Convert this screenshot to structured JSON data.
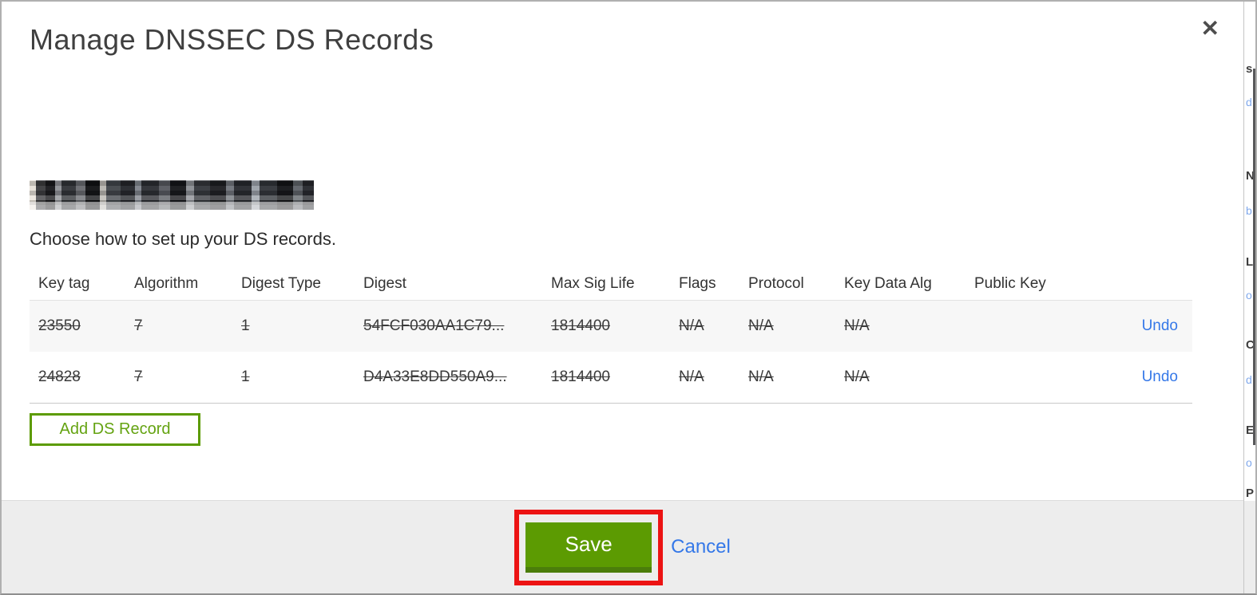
{
  "modal": {
    "title": "Manage DNSSEC DS Records",
    "close_glyph": "✕",
    "domain_redacted": true,
    "instruction": "Choose how to set up your DS records.",
    "table": {
      "headers": [
        "Key tag",
        "Algorithm",
        "Digest Type",
        "Digest",
        "Max Sig Life",
        "Flags",
        "Protocol",
        "Key Data Alg",
        "Public Key"
      ],
      "rows": [
        {
          "key_tag": "23550",
          "algorithm": "7",
          "digest_type": "1",
          "digest": "54FCF030AA1C79...",
          "max_sig_life": "1814400",
          "flags": "N/A",
          "protocol": "N/A",
          "key_data_alg": "N/A",
          "public_key": "",
          "action": "Undo",
          "struck_through": true
        },
        {
          "key_tag": "24828",
          "algorithm": "7",
          "digest_type": "1",
          "digest": "D4A33E8DD550A9...",
          "max_sig_life": "1814400",
          "flags": "N/A",
          "protocol": "N/A",
          "key_data_alg": "N/A",
          "public_key": "",
          "action": "Undo",
          "struck_through": true
        }
      ]
    },
    "add_button_label": "Add DS Record",
    "footer": {
      "save_label": "Save",
      "cancel_label": "Cancel"
    },
    "annotation": {
      "type": "red-highlight-box-around-save",
      "color": "#ec1313"
    }
  },
  "colors": {
    "accent_green": "#5c9b02",
    "accent_green_dark": "#4b7e0b",
    "link_blue": "#3578e8",
    "annotation_red": "#ec1313",
    "row_alt_bg": "#f7f7f7",
    "footer_bg": "#ededed"
  },
  "background_page_edge": {
    "fragments": [
      "s",
      "d",
      "N",
      "b",
      "L",
      "o",
      "C",
      "d",
      "E",
      "o",
      "P"
    ]
  }
}
